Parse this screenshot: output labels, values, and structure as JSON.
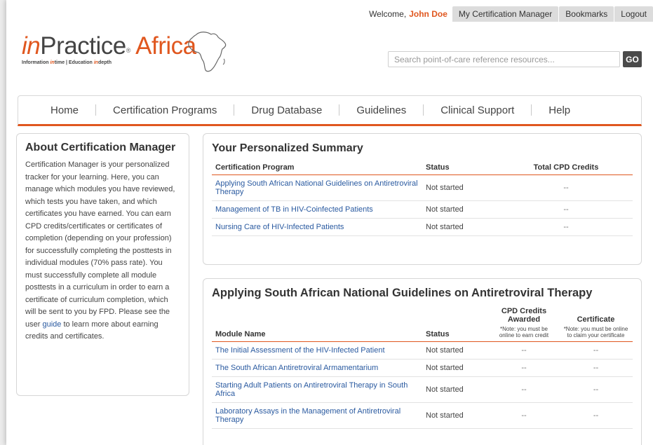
{
  "topbar": {
    "welcome_prefix": "Welcome,",
    "user_name": "John Doe",
    "links": [
      "My Certification Manager",
      "Bookmarks",
      "Logout"
    ]
  },
  "logo": {
    "in": "in",
    "practice": "Practice",
    "africa": "Africa",
    "tagline_1": "Information ",
    "tagline_intime": "in",
    "tagline_2": "time | Education ",
    "tagline_indepth": "in",
    "tagline_3": "depth"
  },
  "search": {
    "placeholder": "Search point-of-care reference resources...",
    "button_label": "GO"
  },
  "nav": [
    "Home",
    "Certification Programs",
    "Drug Database",
    "Guidelines",
    "Clinical Support",
    "Help"
  ],
  "about": {
    "title": "About Certification Manager",
    "body_1": "Certification Manager is your personalized tracker for your learning. Here, you can manage which modules you have reviewed, which tests you have taken, and which certificates you have earned. You can earn CPD credits/certificates or certificates of completion (depending on your profession) for successfully completing the posttests in individual modules (70% pass rate). You must successfully complete all module posttests in a curriculum in order to earn a certificate of curriculum completion, which will be sent to you by FPD. Please see the user ",
    "link": "guide",
    "body_2": " to learn more about earning credits and certificates."
  },
  "summary": {
    "title": "Your Personalized Summary",
    "headers": {
      "program": "Certification Program",
      "status": "Status",
      "credits": "Total CPD Credits"
    },
    "rows": [
      {
        "program": "Applying South African National Guidelines on Antiretroviral Therapy",
        "status": "Not started",
        "credits": "--"
      },
      {
        "program": "Management of TB in HIV-Coinfected Patients",
        "status": "Not started",
        "credits": "--"
      },
      {
        "program": "Nursing Care of HIV-Infected Patients",
        "status": "Not started",
        "credits": "--"
      }
    ]
  },
  "program": {
    "title": "Applying South African National Guidelines on Antiretroviral Therapy",
    "headers": {
      "module": "Module Name",
      "status": "Status",
      "cpd": "CPD Credits Awarded",
      "cpd_note": "*Note: you must be online to earn credit",
      "certificate": "Certificate",
      "certificate_note": "*Note: you must be online to claim your certificate"
    },
    "rows": [
      {
        "module": "The Initial Assessment of the HIV-Infected Patient",
        "status": "Not started",
        "cpd": "--",
        "certificate": "--"
      },
      {
        "module": "The South African Antiretroviral Armamentarium",
        "status": "Not started",
        "cpd": "--",
        "certificate": "--"
      },
      {
        "module": "Starting Adult Patients on Antiretroviral Therapy in South Africa",
        "status": "Not started",
        "cpd": "--",
        "certificate": "--"
      },
      {
        "module": "Laboratory Assays in the Management of Antiretroviral Therapy",
        "status": "Not started",
        "cpd": "--",
        "certificate": "--"
      }
    ]
  }
}
